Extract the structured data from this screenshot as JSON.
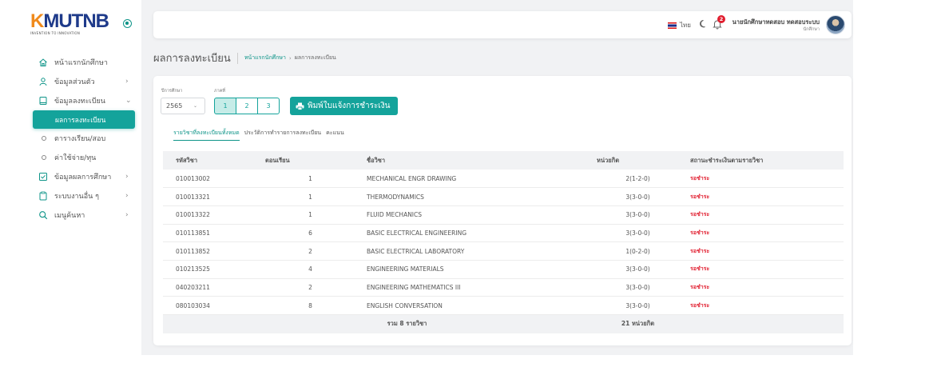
{
  "brand": {
    "name_k": "K",
    "name_rest": "MUTNB",
    "tagline": "INVENTION TO INNOVATION"
  },
  "sidebar": {
    "items": [
      {
        "label": "หน้าแรกนักศึกษา",
        "icon": "home-icon",
        "chevron": ""
      },
      {
        "label": "ข้อมูลส่วนตัว",
        "icon": "user-icon",
        "chevron": "›"
      },
      {
        "label": "ข้อมูลลงทะเบียน",
        "icon": "book-icon",
        "chevron": "⌄"
      },
      {
        "label": "ผลการลงทะเบียน",
        "active": true
      },
      {
        "label": "ตารางเรียน/สอบ",
        "sub": true
      },
      {
        "label": "ค่าใช้จ่าย/ทุน",
        "sub": true
      },
      {
        "label": "ข้อมูลผลการศึกษา",
        "icon": "checkbox-icon",
        "chevron": "›"
      },
      {
        "label": "ระบบงานอื่น ๆ",
        "icon": "clipboard-icon",
        "chevron": "›"
      },
      {
        "label": "เมนูค้นหา",
        "icon": "search-icon",
        "chevron": "›"
      }
    ]
  },
  "topbar": {
    "lang": "ไทย",
    "notification_count": "2",
    "user_name": "นายนักศึกษาทดสอบ ทดสอบระบบ",
    "user_role": "นักศึกษา"
  },
  "page": {
    "title": "ผลการลงทะเบียน",
    "breadcrumb_home": "หน้าแรกนักศึกษา",
    "breadcrumb_sep": "›",
    "breadcrumb_current": "ผลการลงทะเบียน"
  },
  "filters": {
    "year_label": "ปีการศึกษา",
    "term_label": "ภาคที่",
    "year_value": "2565",
    "year_caret": "⌄",
    "terms": [
      "1",
      "2",
      "3"
    ],
    "print_label": "พิมพ์ใบแจ้งการชำระเงิน"
  },
  "tabs": [
    "รายวิชาที่ลงทะเบียนทั้งหมด",
    "ประวัติการทำรายการลงทะเบียน",
    "คะแนน"
  ],
  "table": {
    "headers": [
      "รหัสวิชา",
      "ตอนเรียน",
      "ชื่อวิชา",
      "หน่วยกิต",
      "สถานะชำระเงินตามรายวิชา"
    ],
    "rows": [
      {
        "code": "010013002",
        "section": "1",
        "name": "MECHANICAL ENGR DRAWING",
        "credit": "2(1-2-0)",
        "status": "รอชำระ"
      },
      {
        "code": "010013321",
        "section": "1",
        "name": "THERMODYNAMICS",
        "credit": "3(3-0-0)",
        "status": "รอชำระ"
      },
      {
        "code": "010013322",
        "section": "1",
        "name": "FLUID MECHANICS",
        "credit": "3(3-0-0)",
        "status": "รอชำระ"
      },
      {
        "code": "010113851",
        "section": "6",
        "name": "BASIC ELECTRICAL ENGINEERING",
        "credit": "3(3-0-0)",
        "status": "รอชำระ"
      },
      {
        "code": "010113852",
        "section": "2",
        "name": "BASIC ELECTRICAL LABORATORY",
        "credit": "1(0-2-0)",
        "status": "รอชำระ"
      },
      {
        "code": "010213525",
        "section": "4",
        "name": "ENGINEERING MATERIALS",
        "credit": "3(3-0-0)",
        "status": "รอชำระ"
      },
      {
        "code": "040203211",
        "section": "2",
        "name": "ENGINEERING MATHEMATICS III",
        "credit": "3(3-0-0)",
        "status": "รอชำระ"
      },
      {
        "code": "080103034",
        "section": "8",
        "name": "ENGLISH CONVERSATION",
        "credit": "3(3-0-0)",
        "status": "รอชำระ"
      }
    ],
    "footer_total": "รวม 8 รายวิชา",
    "footer_credits": "21 หน่วยกิต"
  },
  "colors": {
    "accent": "#14a39b",
    "status_pending": "#e11d2e",
    "brand_blue": "#1e3a8a",
    "brand_orange": "#f08a1c"
  }
}
